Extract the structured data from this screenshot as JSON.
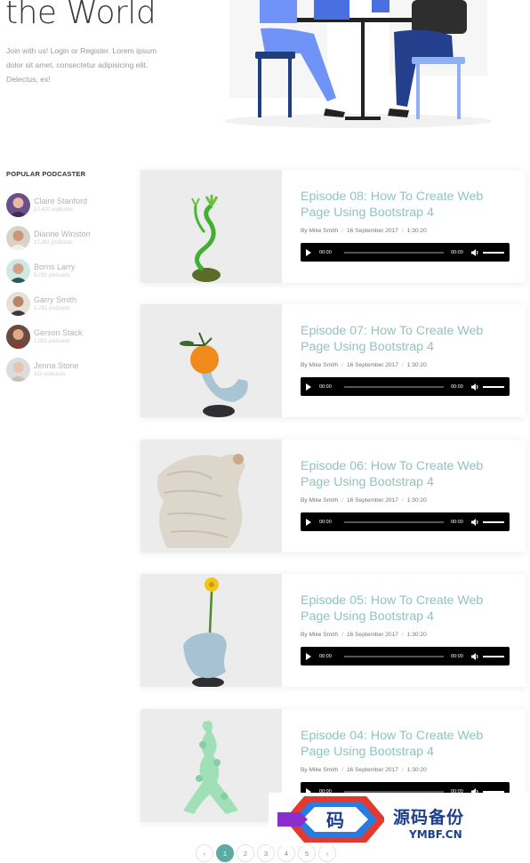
{
  "hero": {
    "title": "the World",
    "text": "Join with us! Login or Register. Lorem ipsum dolor sit amet, consectetur adipisicing elit. Delectus, ex!"
  },
  "sidebar": {
    "heading": "POPULAR PODCASTER",
    "podcasters": [
      {
        "name": "Claire Stanford",
        "count": "12,420 podcasts"
      },
      {
        "name": "Dianne Winston",
        "count": "12,381 podcasts"
      },
      {
        "name": "Borris Larry",
        "count": "8,291 podcasts"
      },
      {
        "name": "Garry Smith",
        "count": "2,291 podcasts"
      },
      {
        "name": "Gerson Stack",
        "count": "1,082 podcasts"
      },
      {
        "name": "Jenna Stone",
        "count": "311 podcasts"
      }
    ]
  },
  "episodes": [
    {
      "title": "Episode 08: How To Create Web Page Using Bootstrap 4",
      "author": "By Mike Smith",
      "date": "16 September 2017",
      "duration": "1:30:20",
      "current_time": "00:00",
      "total_time": "00:00"
    },
    {
      "title": "Episode 07: How To Create Web Page Using Bootstrap 4",
      "author": "By Mike Smith",
      "date": "16 September 2017",
      "duration": "1:30:20",
      "current_time": "00:00",
      "total_time": "00:00"
    },
    {
      "title": "Episode 06: How To Create Web Page Using Bootstrap 4",
      "author": "By Mike Smith",
      "date": "16 September 2017",
      "duration": "1:30:20",
      "current_time": "00:00",
      "total_time": "00:00"
    },
    {
      "title": "Episode 05: How To Create Web Page Using Bootstrap 4",
      "author": "By Mike Smith",
      "date": "16 September 2017",
      "duration": "1:30:20",
      "current_time": "00:00",
      "total_time": "00:00"
    },
    {
      "title": "Episode 04: How To Create Web Page Using Bootstrap 4",
      "author": "By Mike Smith",
      "date": "16 September 2017",
      "duration": "1:30:20",
      "current_time": "00:00",
      "total_time": "00:00"
    }
  ],
  "pagination": {
    "prev": "‹",
    "pages": [
      "1",
      "2",
      "3",
      "4",
      "5"
    ],
    "next": "›",
    "active": "1"
  },
  "watermark": {
    "chinese": "源码备份",
    "domain": "YMBF.CN",
    "logo_char": "码"
  },
  "colors": {
    "accent": "#5da9a6",
    "episode_title": "#8ec4c0"
  }
}
